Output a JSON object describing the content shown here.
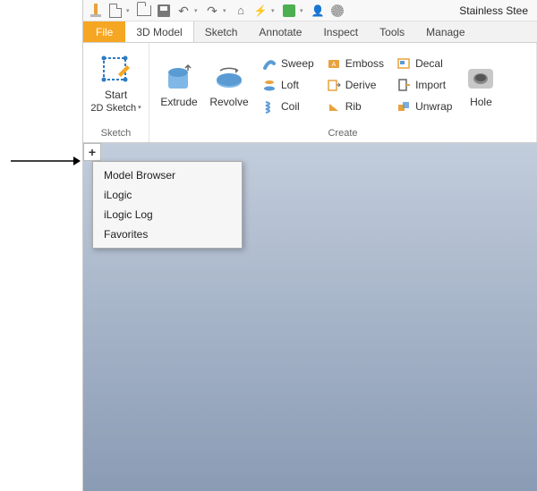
{
  "qat": {
    "material": "Stainless Stee"
  },
  "tabs": {
    "file": "File",
    "items": [
      "3D Model",
      "Sketch",
      "Annotate",
      "Inspect",
      "Tools",
      "Manage"
    ]
  },
  "ribbon": {
    "sketch": {
      "label": "Sketch",
      "start_line1": "Start",
      "start_line2": "2D Sketch"
    },
    "create": {
      "label": "Create",
      "extrude": "Extrude",
      "revolve": "Revolve",
      "sweep": "Sweep",
      "loft": "Loft",
      "coil": "Coil",
      "emboss": "Emboss",
      "derive": "Derive",
      "rib": "Rib",
      "decal": "Decal",
      "import": "Import",
      "unwrap": "Unwrap",
      "hole": "Hole"
    }
  },
  "plus": "+",
  "popup": {
    "items": [
      "Model Browser",
      "iLogic",
      "iLogic Log",
      "Favorites"
    ]
  }
}
